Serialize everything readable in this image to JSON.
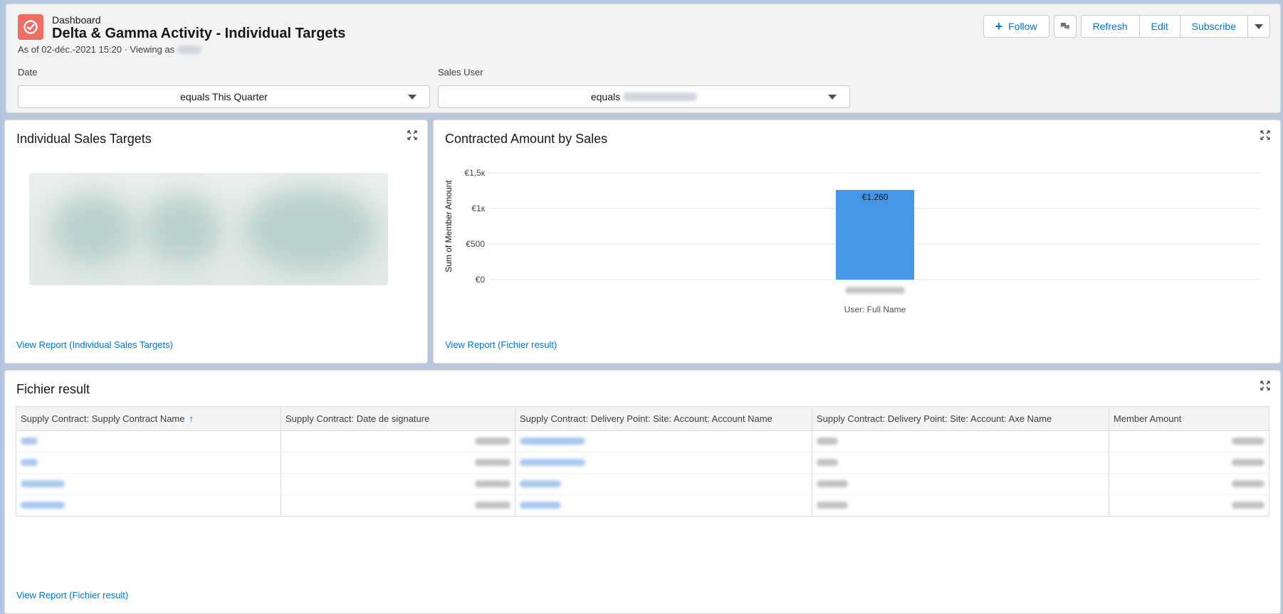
{
  "header": {
    "kicker": "Dashboard",
    "title": "Delta & Gamma Activity - Individual Targets",
    "as_of": "As of 02-déc.-2021 15:20 · Viewing as",
    "buttons": {
      "follow": "Follow",
      "refresh": "Refresh",
      "edit": "Edit",
      "subscribe": "Subscribe"
    }
  },
  "filters": {
    "date": {
      "label": "Date",
      "value": "equals This Quarter"
    },
    "sales_user": {
      "label": "Sales User",
      "value": "equals"
    }
  },
  "cards": {
    "targets": {
      "title": "Individual Sales Targets",
      "link": "View Report (Individual Sales Targets)"
    },
    "contracted": {
      "title": "Contracted Amount by Sales",
      "link": "View Report (Fichier result)"
    },
    "fichier": {
      "title": "Fichier result",
      "link": "View Report (Fichier result)"
    }
  },
  "chart_data": {
    "type": "bar",
    "categories": [
      ""
    ],
    "values": [
      1260
    ],
    "data_labels": [
      "€1.260"
    ],
    "title": "Contracted Amount by Sales",
    "xlabel": "User: Full Name",
    "ylabel": "Sum of Member Amount",
    "ylim": [
      0,
      1500
    ],
    "yticks": [
      0,
      500,
      1000,
      1500
    ],
    "ytick_labels": [
      "€0",
      "€500",
      "€1к",
      "€1,5к"
    ],
    "grid": true,
    "color": "#4596e6"
  },
  "table": {
    "columns": [
      "Supply Contract: Supply Contract Name",
      "Supply Contract: Date de signature",
      "Supply Contract: Delivery Point: Site: Account: Account Name",
      "Supply Contract: Delivery Point: Site: Account: Axe Name",
      "Member Amount"
    ],
    "sort_indicator": "↑",
    "row_count": 4
  },
  "colors": {
    "accent": "#0176d3",
    "app_icon": "#ef6e64",
    "bar": "#4596e6"
  }
}
